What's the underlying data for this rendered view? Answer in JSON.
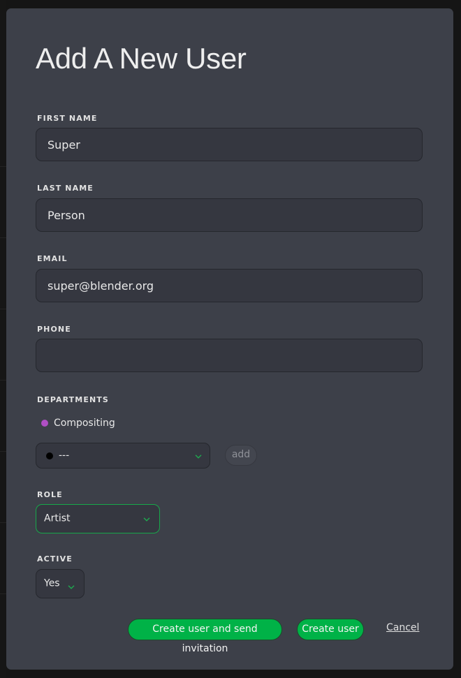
{
  "dialog": {
    "title": "Add A New User",
    "fields": {
      "first_name": {
        "label": "FIRST NAME",
        "value": "Super"
      },
      "last_name": {
        "label": "LAST NAME",
        "value": "Person"
      },
      "email": {
        "label": "EMAIL",
        "value": "super@blender.org"
      },
      "phone": {
        "label": "PHONE",
        "value": ""
      }
    },
    "departments": {
      "label": "DEPARTMENTS",
      "items": [
        {
          "name": "Compositing",
          "color": "#b04fc4"
        }
      ],
      "select": {
        "value": "---",
        "dot_color": "#000000"
      },
      "add_label": "add"
    },
    "role": {
      "label": "ROLE",
      "value": "Artist"
    },
    "active": {
      "label": "ACTIVE",
      "value": "Yes"
    },
    "actions": {
      "create_and_invite": "Create user and send invitation",
      "create": "Create user",
      "cancel": "Cancel"
    }
  },
  "colors": {
    "accent_green": "#00b247",
    "chevron_green": "#1fa84f"
  }
}
